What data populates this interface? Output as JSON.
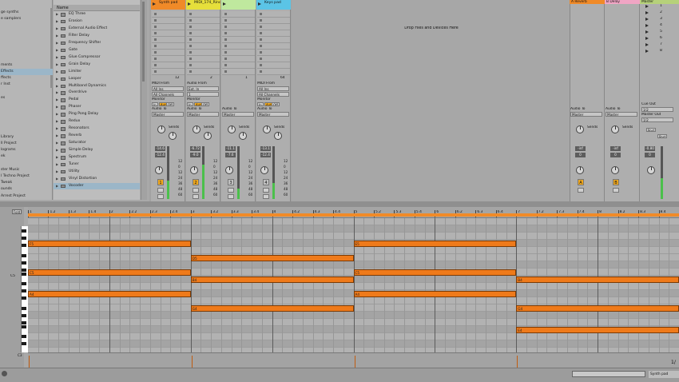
{
  "browser_left": {
    "items": [
      "ge synths",
      "e samplers",
      "",
      "",
      "",
      "",
      "",
      "",
      "ments",
      "Effects",
      "ffects",
      "r Inst",
      "",
      "es",
      "",
      "",
      "",
      "",
      "",
      "Library",
      "ll Project",
      "lograms",
      "ek",
      "",
      "ster Music",
      "l Techno Project",
      "Tweak",
      "ounds",
      "Arrest Project"
    ],
    "selected_index": 9
  },
  "browser_list": {
    "header": "Name",
    "items": [
      "EQ Three",
      "Erosion",
      "External Audio Effect",
      "Filter Delay",
      "Frequency Shifter",
      "Gate",
      "Glue Compressor",
      "Grain Delay",
      "Limiter",
      "Looper",
      "Multiband Dynamics",
      "Overdrive",
      "Pedal",
      "Phaser",
      "Ping Pong Delay",
      "Redux",
      "Resonators",
      "Reverb",
      "Saturator",
      "Simple Delay",
      "Spectrum",
      "Tuner",
      "Utility",
      "Vinyl Distortion",
      "Vocoder"
    ],
    "selected_index": 24
  },
  "tracks": [
    {
      "name": "Synth pad",
      "color": "#f08a28",
      "number": "1",
      "armed": true,
      "input_label": "MIDI From",
      "input": "All Ins",
      "channel": "All Channels",
      "monitor": [
        "In",
        "Auto",
        "Off"
      ],
      "audio_to": "Master",
      "volume": "-14.6",
      "pan": "-12.4",
      "meter": 0.35
    },
    {
      "name": "MIDI_174_Rino",
      "color": "#e6df3b",
      "number": "2",
      "armed": true,
      "input_label": "Audio From",
      "input": "Ext. In",
      "channel": "1",
      "monitor": [
        "In",
        "Auto",
        "Off"
      ],
      "audio_to": "Master",
      "volume": "-6.72",
      "pan": "-9.0",
      "meter": 0.65
    },
    {
      "name": "",
      "color": "#bfe89e",
      "number": "3",
      "armed": false,
      "input_label": "",
      "input": "",
      "channel": "",
      "monitor": [
        "",
        "",
        ""
      ],
      "audio_to": "Master",
      "volume": "-11.1",
      "pan": "-7.6",
      "meter": 0.2
    },
    {
      "name": "Keys pad",
      "color": "#5bc4e6",
      "number": "4",
      "armed": false,
      "input_label": "MIDI From",
      "input": "All Ins",
      "channel": "All Channels",
      "monitor": [
        "In",
        "Auto",
        "Off"
      ],
      "audio_to": "Master",
      "volume": "-13.1",
      "pan": "-12.4",
      "meter": 0.3
    }
  ],
  "track_section_labels": {
    "monitor": "Monitor",
    "audio_to": "Audio To",
    "sends": "Sends"
  },
  "db_scale": [
    "12",
    "0",
    "12",
    "24",
    "36",
    "48",
    "60"
  ],
  "clip_slot_counts": [
    "12",
    "2",
    "1",
    "64"
  ],
  "drop_zone_text": "Drop Files and Devices Here",
  "returns": [
    {
      "name": "A Reverb",
      "color": "#f08a28",
      "letter": "A",
      "audio_to": "Master",
      "volume": "-inf",
      "pan": "0"
    },
    {
      "name": "B Delay",
      "color": "#f0a5c4",
      "letter": "B",
      "audio_to": "Master",
      "volume": "-inf",
      "pan": "0"
    }
  ],
  "master": {
    "name": "Master",
    "scene_numbers": [
      "1",
      "2",
      "3",
      "4",
      "5",
      "6",
      "7",
      "8"
    ],
    "cue_out_label": "Cue Out",
    "cue_out": "1/2",
    "master_out_label": "Master Out",
    "master_out": "1/2",
    "volume": "-0.80",
    "pan": "0",
    "post1": "Post",
    "post2": "Post"
  },
  "clip_view": {
    "fold_label": "Fold",
    "key_label": "C5",
    "key_label_low": "C3",
    "page": "1/",
    "ruler_ticks": [
      "1",
      "1.2",
      "1.3",
      "1.4",
      "2",
      "2.2",
      "2.3",
      "2.4",
      "3",
      "3.2",
      "3.3",
      "3.4",
      "4",
      "4.2",
      "4.3",
      "4.4",
      "5",
      "5.2",
      "5.3",
      "5.4",
      "6",
      "6.2",
      "6.3",
      "6.4",
      "7",
      "7.2",
      "7.3",
      "7.4",
      "8",
      "8.2",
      "8.3",
      "8.4"
    ],
    "notes": [
      {
        "pitch": "F5",
        "start": 0,
        "end": 0.25,
        "row": 3
      },
      {
        "pitch": "D5",
        "start": 0.25,
        "end": 0.5,
        "row": 5
      },
      {
        "pitch": "C5",
        "start": 0,
        "end": 0.25,
        "row": 7
      },
      {
        "pitch": "B4",
        "start": 0.25,
        "end": 0.5,
        "row": 8
      },
      {
        "pitch": "A4",
        "start": 0,
        "end": 0.25,
        "row": 10
      },
      {
        "pitch": "G4",
        "start": 0.25,
        "end": 0.5,
        "row": 12
      },
      {
        "pitch": "E5",
        "start": 0.5,
        "end": 0.75,
        "row": 3
      },
      {
        "pitch": "C5",
        "start": 0.5,
        "end": 0.75,
        "row": 7
      },
      {
        "pitch": "A4",
        "start": 0.5,
        "end": 0.75,
        "row": 10
      },
      {
        "pitch": "B4",
        "start": 0.75,
        "end": 1,
        "row": 8
      },
      {
        "pitch": "G4",
        "start": 0.75,
        "end": 1,
        "row": 12
      },
      {
        "pitch": "E4",
        "start": 0.75,
        "end": 1,
        "row": 15
      }
    ]
  },
  "status": {
    "track_label": "Synth pad"
  }
}
